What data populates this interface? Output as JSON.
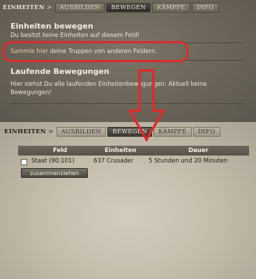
{
  "top": {
    "tab_category": "EINHEITEN",
    "tab_sep": ">",
    "tabs": [
      "AUSBILDEN",
      "BEWEGEN",
      "KÄMPFE",
      "INFO"
    ],
    "active_tab": "BEWEGEN",
    "move_title": "Einheiten bewegen",
    "move_text": "Du besitzt keine Einheiten auf diesem Feld!",
    "gather_link": "Sammle hier",
    "gather_rest": " deine Truppen von anderen Feldern.",
    "running_title": "Laufende Bewegungen",
    "running_text_1": "Hier siehst Du alle laufenden Einheitenbewegungen: Aktuell keine",
    "running_text_2": "Bewegungen!"
  },
  "bottom": {
    "tab_category": "EINHEITEN",
    "tab_sep": ">",
    "tabs": [
      "AUSBILDEN",
      "BEWEGEN",
      "KÄMPFE",
      "INFO"
    ],
    "active_tab": "BEWEGEN",
    "table": {
      "headers": [
        "Feld",
        "Einheiten",
        "Dauer"
      ],
      "row": {
        "field": "Staat (90:101)",
        "units": "637 Crusader",
        "duration": "5 Stunden und 20 Minuten"
      }
    },
    "gather_button": "zusammenziehen"
  },
  "colors": {
    "highlight": "#e02a2a",
    "link": "#f0c9a3"
  }
}
